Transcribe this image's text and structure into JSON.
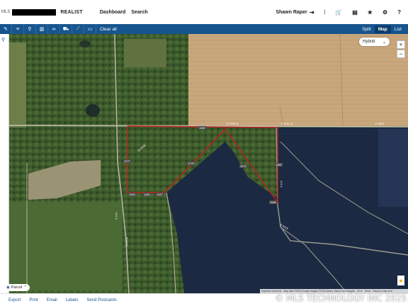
{
  "header": {
    "logo_text": "MLS",
    "app_name": "REALIST",
    "nav": [
      "Dashboard",
      "Search"
    ],
    "user_name": "Shawn Raper",
    "separator": "|"
  },
  "toolbar": {
    "clear_all": "Clear all",
    "view_tabs": [
      "Split",
      "Map",
      "List"
    ],
    "active_view": "Map"
  },
  "map": {
    "map_type": "Hybrid",
    "zoom_in": "+",
    "zoom_out": "−",
    "parcel_label": "Parcel",
    "road_labels": {
      "e_top_left": "E 0780 S",
      "e_top_right": "E 0781 S",
      "e_far_right": "E 0921",
      "s_right_road": "S 0 4",
      "ns_left": "N 0 4",
      "n_bottom": "N 4210",
      "rd_left": "N 4205",
      "s_bottom": "S 4215"
    },
    "parcel_tags": [
      "1177",
      "1178",
      "1179",
      "1162",
      "1163",
      "1164",
      "1167",
      "1165",
      "1166"
    ],
    "attribution": [
      "Keyboard shortcuts",
      "Map data ©2025 Google Imagery ©2025 Airbus, Maxar Technologies",
      "50 m",
      "Terms",
      "Report a map error"
    ]
  },
  "bottom_bar": {
    "actions": [
      "Export",
      "Print",
      "Email",
      "Labels",
      "Send Postcards"
    ]
  },
  "watermark": "© MLS TECHNOLOGY INC 2025",
  "colors": {
    "toolbar_blue": "#17558e",
    "boundary_red": "#c81e1e",
    "field_tan": "#c8a77c",
    "water_navy": "#1c2a44",
    "trees_green": "#3c5a2a"
  }
}
